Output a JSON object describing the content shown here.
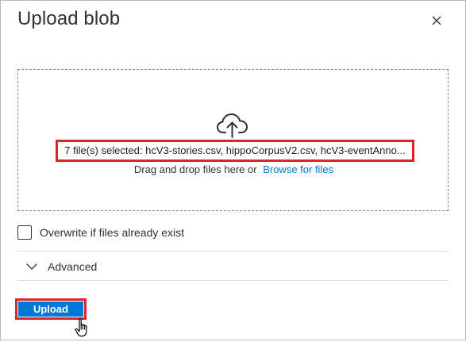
{
  "dialog": {
    "title": "Upload blob",
    "close_icon": "close-icon"
  },
  "dropzone": {
    "icon": "cloud-upload-icon",
    "selected_files_text": "7 file(s) selected: hcV3-stories.csv, hippoCorpusV2.csv, hcV3-eventAnno...",
    "drag_text": "Drag and drop files here  or",
    "browse_link": "Browse for files"
  },
  "options": {
    "overwrite_label": "Overwrite if files already exist",
    "overwrite_checked": false,
    "advanced_label": "Advanced",
    "advanced_icon": "chevron-down-icon"
  },
  "footer": {
    "upload_label": "Upload"
  },
  "colors": {
    "accent": "#0078d4",
    "highlight": "#d9262e",
    "text": "#323130"
  }
}
